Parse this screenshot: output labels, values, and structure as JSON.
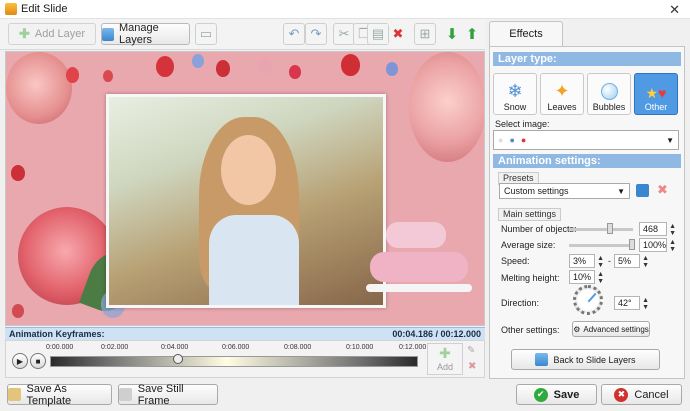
{
  "window": {
    "title": "Edit Slide"
  },
  "toolbar": {
    "add_layer": "Add Layer",
    "manage_layers": "Manage Layers"
  },
  "timeline": {
    "title": "Animation Keyframes:",
    "time": "00:04.186 / 00:12.000",
    "ticks": [
      "0:00.000",
      "0:02.000",
      "0:04.000",
      "0:06.000",
      "0:08.000",
      "0:10.000",
      "0:12.000"
    ],
    "add_label": "Add",
    "position_fraction": 0.349
  },
  "bottom": {
    "save_as_template": "Save As Template",
    "save_still_frame": "Save Still Frame",
    "save": "Save",
    "cancel": "Cancel"
  },
  "panel": {
    "tab": "Effects",
    "layer_type_title": "Layer type:",
    "layer_types": [
      "Snow",
      "Leaves",
      "Bubbles",
      "Other"
    ],
    "selected_type": "Other",
    "select_image_label": "Select image:",
    "animation_settings_title": "Animation settings:",
    "presets_label": "Presets",
    "preset_value": "Custom settings",
    "main_settings_label": "Main settings",
    "number_of_objects_label": "Number of objects:",
    "number_of_objects": "468",
    "average_size_label": "Average size:",
    "average_size": "100%",
    "speed_label": "Speed:",
    "speed_from": "3%",
    "speed_to": "5%",
    "melting_height_label": "Melting height:",
    "melting_height": "10%",
    "direction_label": "Direction:",
    "direction": "42°",
    "other_settings_label": "Other settings:",
    "advanced_settings": "Advanced settings",
    "back_to_slide_layers": "Back to Slide Layers"
  },
  "colors": {
    "accent": "#4f9ae3",
    "section": "#8fb9e2",
    "canvas_bg": "#e9a8ae",
    "save_green": "#2faa3d",
    "cancel_red": "#d0312d"
  },
  "icons": [
    "app-icon",
    "close-icon",
    "add-layer-icon",
    "manage-layers-icon",
    "undo-icon",
    "redo-icon",
    "cut-icon",
    "copy-icon",
    "paste-icon",
    "delete-icon",
    "arrow-down-icon",
    "arrow-up-icon",
    "play-icon",
    "stop-icon",
    "disk-icon",
    "check-icon",
    "cancel-icon"
  ]
}
